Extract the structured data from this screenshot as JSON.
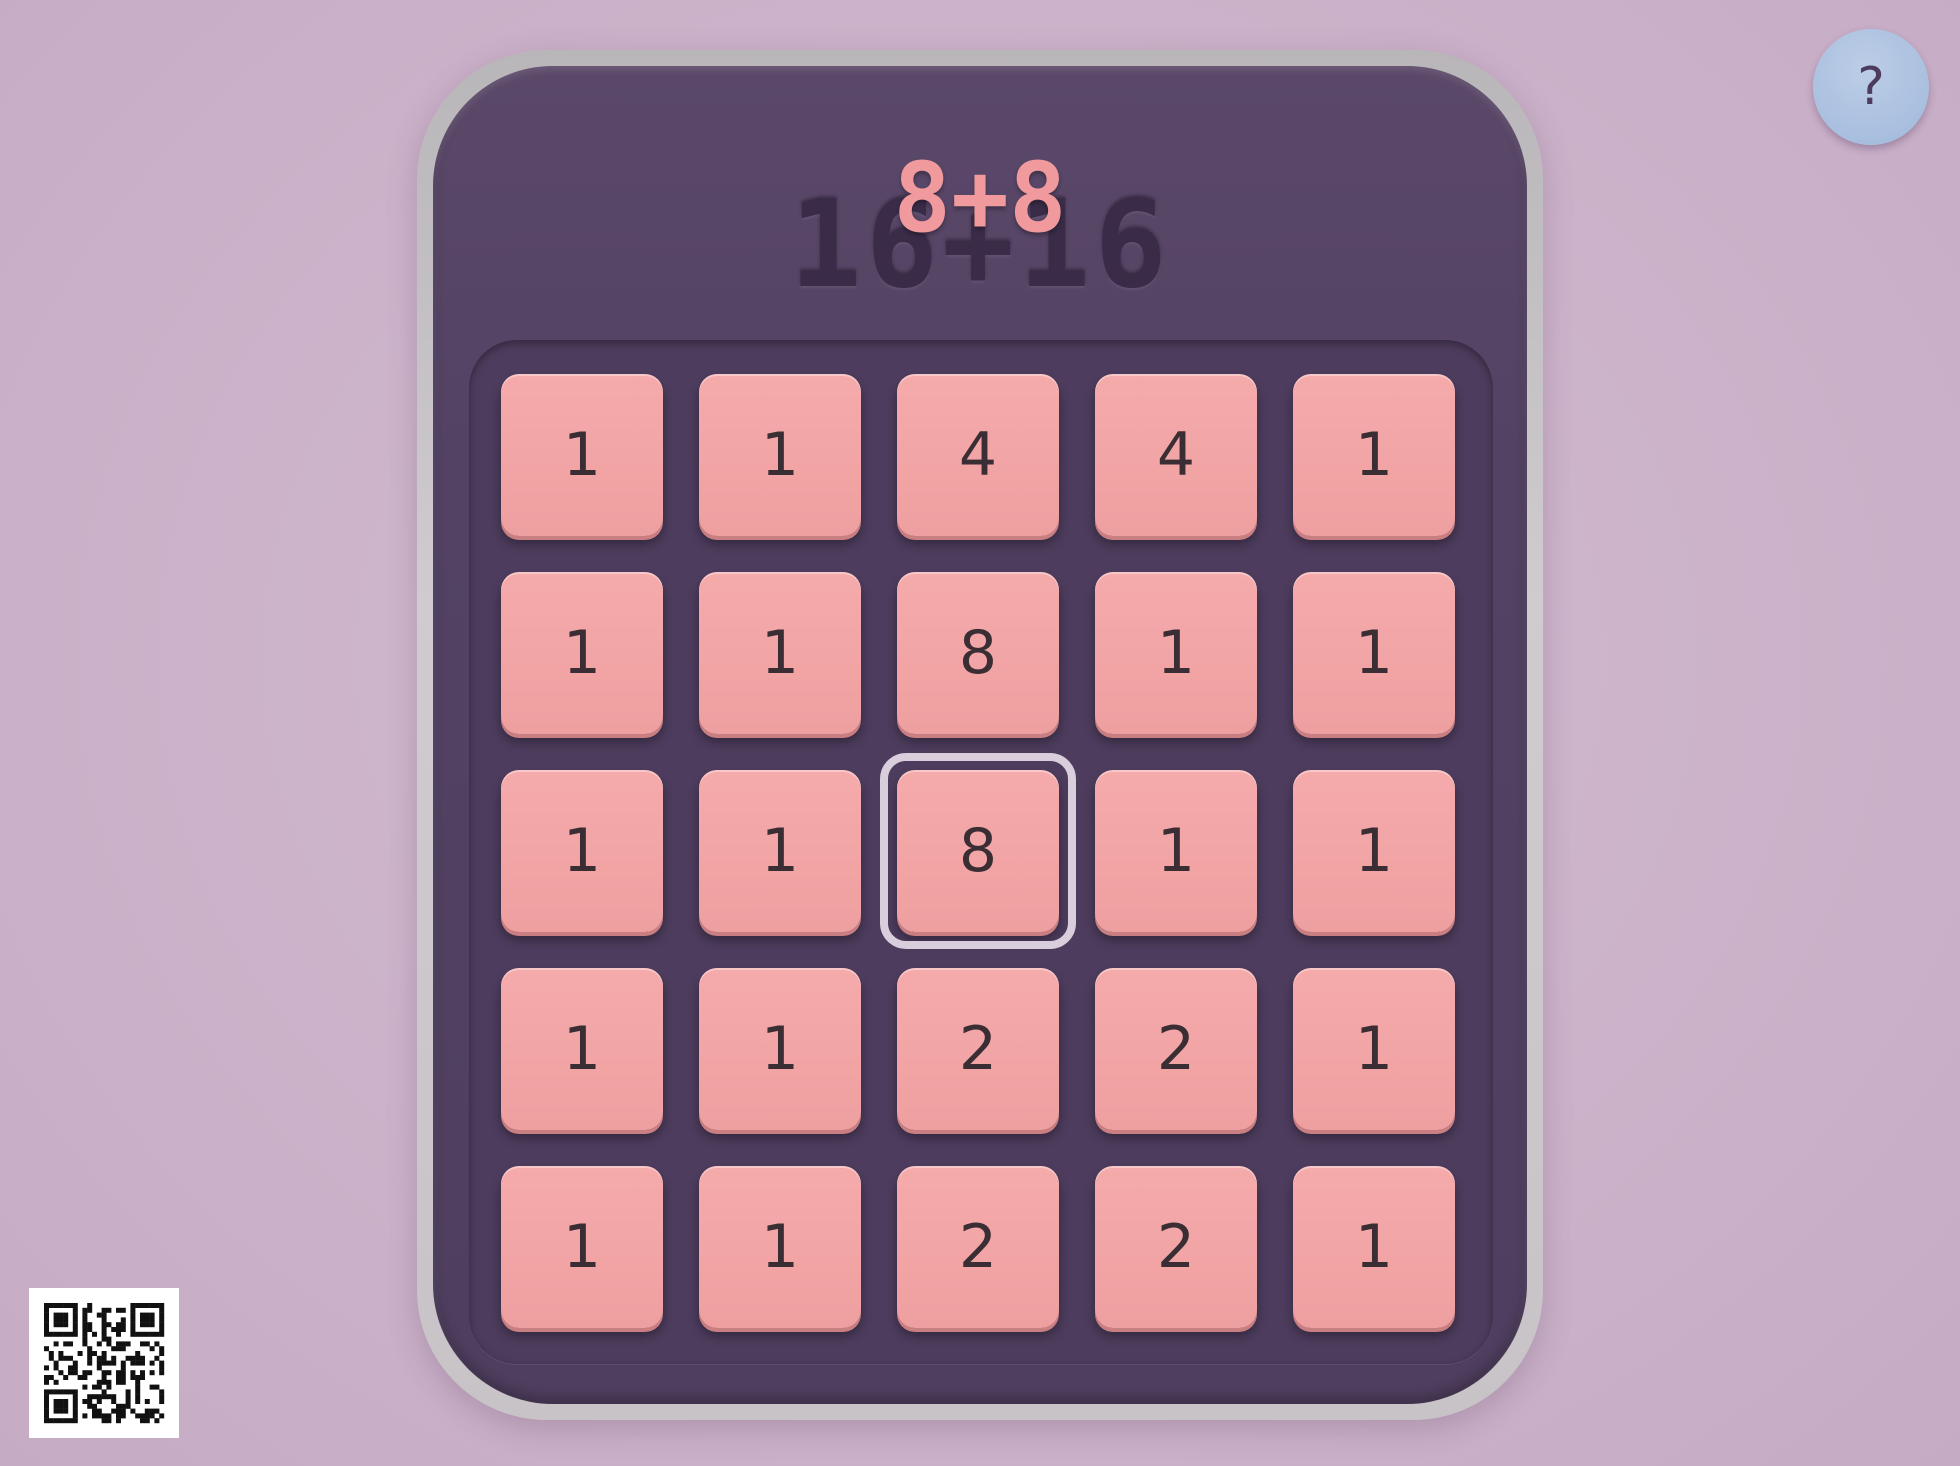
{
  "score": {
    "total": "16+16",
    "last_gain": "8+8"
  },
  "help_button": {
    "label": "?"
  },
  "board": {
    "rows": [
      [
        "1",
        "1",
        "4",
        "4",
        "1"
      ],
      [
        "1",
        "1",
        "8",
        "1",
        "1"
      ],
      [
        "1",
        "1",
        "8",
        "1",
        "1"
      ],
      [
        "1",
        "1",
        "2",
        "2",
        "1"
      ],
      [
        "1",
        "1",
        "2",
        "2",
        "1"
      ]
    ],
    "selected_row": 2,
    "selected_col": 2
  },
  "colors": {
    "background": "#cdb4ca",
    "device": "#534264",
    "tile": "#f2a4a5",
    "accent_text": "#f09a9d",
    "help_button": "#a9bfdf"
  },
  "icons": {
    "qr": "qr-code-icon"
  }
}
